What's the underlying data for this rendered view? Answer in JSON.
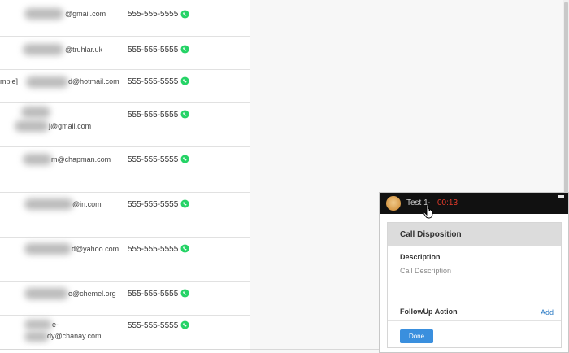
{
  "contacts": [
    {
      "prefix": "",
      "email_visible": "@gmail.com",
      "phone": "555-555-5555"
    },
    {
      "prefix": "",
      "email_visible": "@truhlar.uk",
      "phone": "555-555-5555"
    },
    {
      "prefix": "mple]",
      "email_visible": "d@hotmail.com",
      "phone": "555-555-5555"
    },
    {
      "prefix": "",
      "email_visible": "j@gmail.com",
      "phone": "555-555-5555"
    },
    {
      "prefix": "",
      "email_visible": "m@chapman.com",
      "phone": "555-555-5555"
    },
    {
      "prefix": "",
      "email_visible": "@in.com",
      "phone": "555-555-5555"
    },
    {
      "prefix": "",
      "email_visible": "d@yahoo.com",
      "phone": "555-555-5555"
    },
    {
      "prefix": "",
      "email_visible": "e@chemel.org",
      "phone": "555-555-5555"
    },
    {
      "prefix": "",
      "email_line1": "e-",
      "email_visible": "dy@chanay.com",
      "phone": "555-555-5555"
    }
  ],
  "call_widget": {
    "caller": "Test 1",
    "separator": "-",
    "timer": "00:13",
    "minimize_icon": "minimize-icon",
    "disposition": {
      "title": "Call Disposition",
      "description_label": "Description",
      "description_placeholder": "Call Description",
      "followup_label": "FollowUp Action",
      "add_label": "Add",
      "done_label": "Done"
    }
  },
  "colors": {
    "whatsapp": "#25d366",
    "timer": "#e23a2a",
    "link": "#2a7ac4",
    "done": "#3a8fde",
    "header": "#111111"
  }
}
